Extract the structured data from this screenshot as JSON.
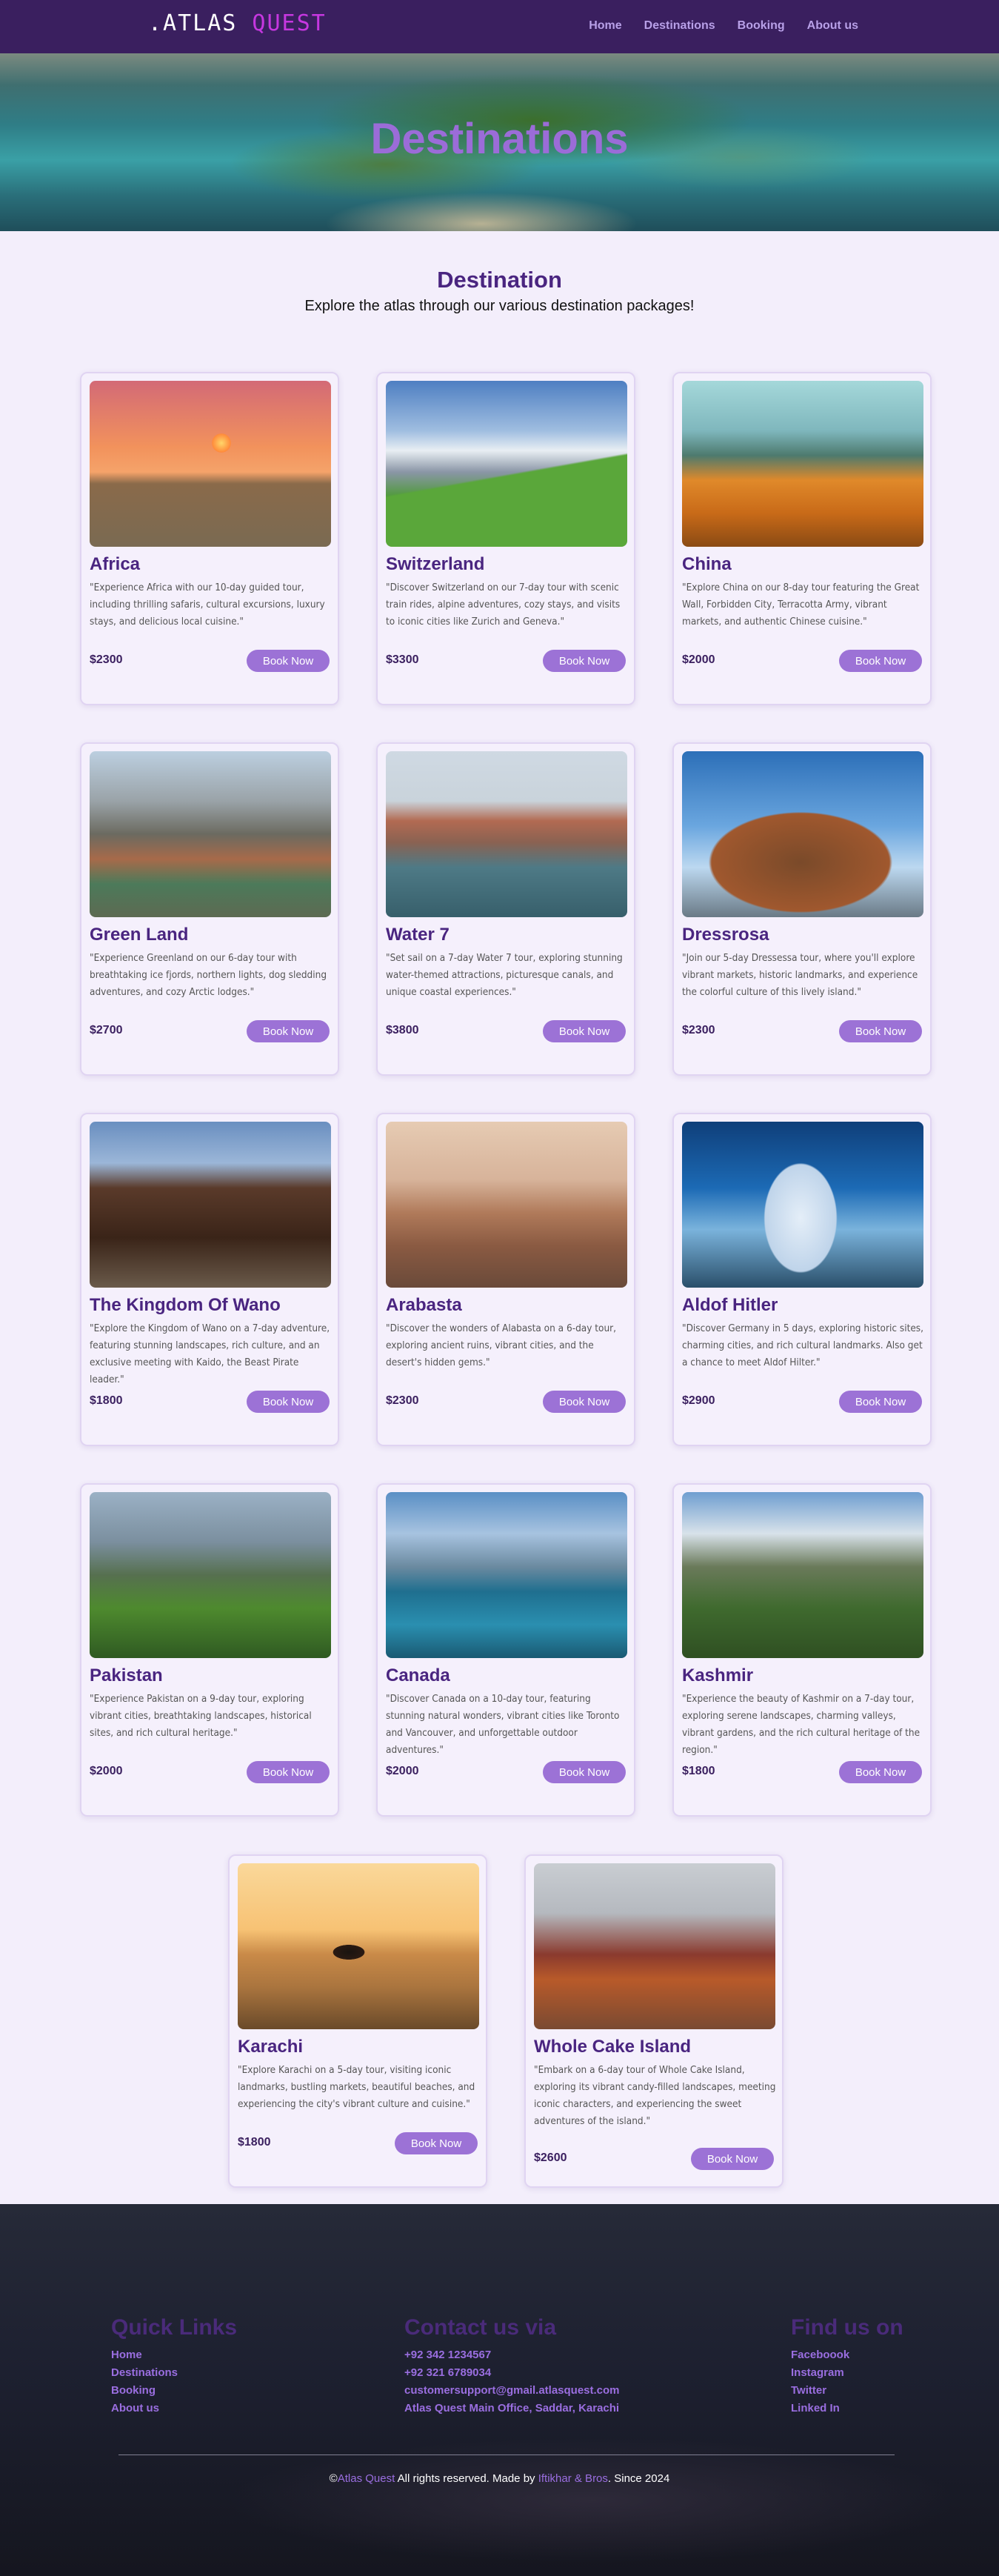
{
  "nav": {
    "logo_part1": ".ATLAS",
    "logo_part2": " QUEST",
    "links": [
      "Home",
      "Destinations",
      "Booking",
      "About us"
    ]
  },
  "hero": {
    "title": "Destinations"
  },
  "section": {
    "title": "Destination",
    "subtitle": "Explore the atlas through our various destination packages!"
  },
  "book_label": "Book Now",
  "cards": [
    {
      "name": "Africa",
      "desc": "\"Experience Africa with our 10-day guided tour, including thrilling safaris, cultural excursions, luxury stays, and delicious local cuisine.\"",
      "price": "$2300"
    },
    {
      "name": "Switzerland",
      "desc": "\"Discover Switzerland on our 7-day tour with scenic train rides, alpine adventures, cozy stays, and visits to iconic cities like Zurich and Geneva.\"",
      "price": "$3300"
    },
    {
      "name": "China",
      "desc": "\"Explore China on our 8-day tour featuring the Great Wall, Forbidden City, Terracotta Army, vibrant markets, and authentic Chinese cuisine.\"",
      "price": "$2000"
    },
    {
      "name": "Green Land",
      "desc": "\"Experience Greenland on our 6-day tour with breathtaking ice fjords, northern lights, dog sledding adventures, and cozy Arctic lodges.\"",
      "price": "$2700"
    },
    {
      "name": "Water 7",
      "desc": "\"Set sail on a 7-day Water 7 tour, exploring stunning water-themed attractions, picturesque canals, and unique coastal experiences.\"",
      "price": "$3800"
    },
    {
      "name": "Dressrosa",
      "desc": "\"Join our 5-day Dressessa tour, where you'll explore vibrant markets, historic landmarks, and experience the colorful culture of this lively island.\"",
      "price": "$2300"
    },
    {
      "name": "The Kingdom Of Wano",
      "desc": "\"Explore the Kingdom of Wano on a 7-day adventure, featuring stunning landscapes, rich culture, and an exclusive meeting with Kaido, the Beast Pirate leader.\"",
      "price": "$1800"
    },
    {
      "name": "Arabasta",
      "desc": "\"Discover the wonders of Alabasta on a 6-day tour, exploring ancient ruins, vibrant cities, and the desert's hidden gems.\"",
      "price": "$2300"
    },
    {
      "name": "Aldof Hitler",
      "desc": "\"Discover Germany in 5 days, exploring historic sites, charming cities, and rich cultural landmarks. Also get a chance to meet Aldof Hilter.\"",
      "price": "$2900"
    },
    {
      "name": "Pakistan",
      "desc": "\"Experience Pakistan on a 9-day tour, exploring vibrant cities, breathtaking landscapes, historical sites, and rich cultural heritage.\"",
      "price": "$2000"
    },
    {
      "name": "Canada",
      "desc": "\"Discover Canada on a 10-day tour, featuring stunning natural wonders, vibrant cities like Toronto and Vancouver, and unforgettable outdoor adventures.\"",
      "price": "$2000"
    },
    {
      "name": "Kashmir",
      "desc": "\"Experience the beauty of Kashmir on a 7-day tour, exploring serene landscapes, charming valleys, vibrant gardens, and the rich cultural heritage of the region.\"",
      "price": "$1800"
    },
    {
      "name": "Karachi",
      "desc": "\"Explore Karachi on a 5-day tour, visiting iconic landmarks, bustling markets, beautiful beaches, and experiencing the city's vibrant culture and cuisine.\"",
      "price": "$1800"
    },
    {
      "name": "Whole Cake Island",
      "desc": "\"Embark on a 6-day tour of Whole Cake Island, exploring its vibrant candy-filled landscapes, meeting iconic characters, and experiencing the sweet adventures of the island.\"",
      "price": "$2600"
    }
  ],
  "footer": {
    "quick_links_title": "Quick Links",
    "quick_links": [
      "Home",
      "Destinations",
      "Booking",
      "About us"
    ],
    "contact_title": "Contact us via",
    "contact": [
      "+92 342 1234567",
      "+92 321 6789034",
      "customersupport@gmail.atlasquest.com",
      "Atlas Quest Main Office, Saddar, Karachi"
    ],
    "find_title": "Find us on",
    "social": [
      "Faceboook",
      "Instagram",
      "Twitter",
      "Linked In"
    ],
    "copy_prefix": "©",
    "copy_brand": "Atlas Quest",
    "copy_mid": " All rights reserved. Made by ",
    "copy_author": "Iftikhar & Bros",
    "copy_suffix": ". Since 2024"
  }
}
